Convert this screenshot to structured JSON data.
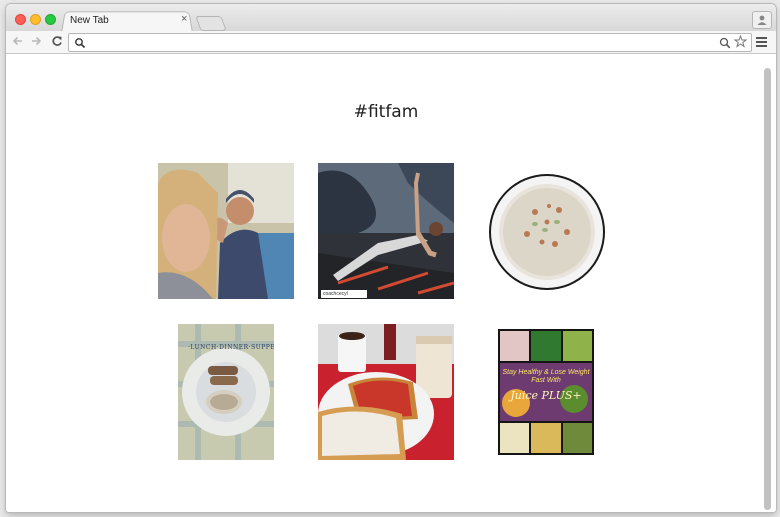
{
  "browser": {
    "tab_title": "New Tab",
    "tab_close": "×",
    "address_value": "",
    "icons": [
      "back-arrow-icon",
      "forward-arrow-icon",
      "reload-icon",
      "search-icon",
      "zoom-icon",
      "star-icon",
      "menu-icon",
      "profile-icon"
    ]
  },
  "page": {
    "heading": "#fitfam",
    "photos": [
      {
        "subject": "selfie-gym-couple"
      },
      {
        "subject": "side-plank-gym",
        "credit": "coachcecyl"
      },
      {
        "subject": "oatmeal-bowl"
      },
      {
        "subject": "breakfast-lunch-dinner-plate",
        "plate_text": "·LUNCH·DINNER·SUPPER·BREAKFAST"
      },
      {
        "subject": "toast-and-coffee"
      },
      {
        "subject": "juice-plus-collage",
        "caption": "Stay Healthy & Lose Weight Fast With",
        "brand": "Juice PLUS+"
      }
    ]
  }
}
